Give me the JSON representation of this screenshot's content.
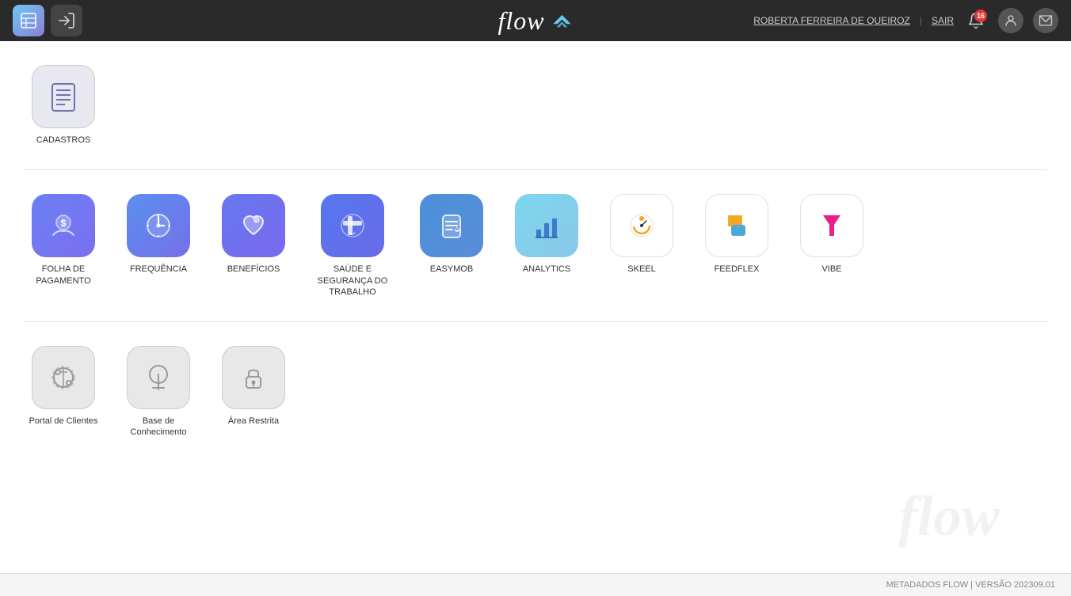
{
  "topnav": {
    "home_icon": "home-icon",
    "exit_icon": "exit-icon",
    "logo_text": "flow",
    "user_name": "ROBERTA FERREIRA DE QUEIROZ",
    "sair": "SAIR",
    "notif_count": "16"
  },
  "sections": {
    "section1_label": "CADASTROS",
    "section2_apps": [
      {
        "id": "folha",
        "label": "FOLHA DE\nPAGAMENTO",
        "color": "blue1"
      },
      {
        "id": "frequencia",
        "label": "FREQUÊNCIA",
        "color": "blue2"
      },
      {
        "id": "beneficios",
        "label": "BENEFÍCIOS",
        "color": "blue3"
      },
      {
        "id": "saude",
        "label": "SAÚDE E\nSEGURANÇA DO\nTRABALHO",
        "color": "blue4"
      },
      {
        "id": "easymob",
        "label": "EASYMOB",
        "color": "blue5"
      },
      {
        "id": "analytics",
        "label": "ANALYTICS",
        "color": "cyan"
      },
      {
        "id": "skeel",
        "label": "SKEEL",
        "color": "white_orange"
      },
      {
        "id": "feedflex",
        "label": "FEEDFLEX",
        "color": "white_feedflex"
      },
      {
        "id": "vibe",
        "label": "VIBE",
        "color": "white_vibe"
      }
    ],
    "section3_apps": [
      {
        "id": "portal",
        "label": "Portal de Clientes",
        "color": "gray"
      },
      {
        "id": "base",
        "label": "Base de\nConhecimento",
        "color": "gray"
      },
      {
        "id": "restrita",
        "label": "Área Restrita",
        "color": "gray"
      }
    ]
  },
  "footer": {
    "text": "METADADOS FLOW | VERSÃO 202309.01"
  },
  "watermark": "flow"
}
